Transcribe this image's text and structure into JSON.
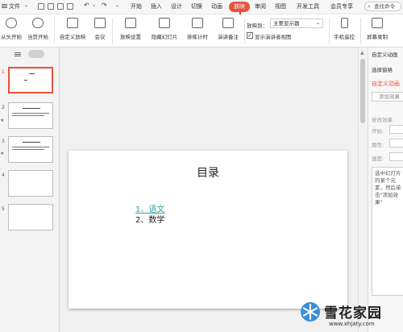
{
  "menubar": {
    "file_label": "文件",
    "tabs": [
      "开始",
      "插入",
      "设计",
      "切换",
      "动画",
      "放映",
      "审阅",
      "视图",
      "开发工具",
      "会员专享"
    ],
    "active_tab": "放映",
    "search_label": "查找命令"
  },
  "ribbon": {
    "from_start": "从头开始",
    "from_current": "当页开始",
    "custom_show": "自定义放映",
    "meeting": "会议",
    "show_settings": "放映设置",
    "hide_slide": "隐藏幻灯片",
    "rehearse": "排练计时",
    "speaker_notes": "演讲备注",
    "show_to_label": "放映到：",
    "show_to_value": "主要显示器",
    "presenter_view": "显示演讲者视图",
    "phone_remote": "手机遥控",
    "screen_record": "屏幕录制"
  },
  "thumbnails": {
    "numbers": [
      "1",
      "2",
      "3",
      "4",
      "5"
    ],
    "star": "★"
  },
  "slide": {
    "title": "目录",
    "items": [
      "1、语文",
      "2、数学"
    ],
    "item1_color": "#2aa6a6"
  },
  "right_panel": {
    "header": "自定义动画",
    "select_pane": "选择窗格",
    "custom_anim": "自定义动画",
    "add_effect": "添加效果",
    "modify_effect": "修改效果",
    "start": "开始:",
    "property": "属性:",
    "speed": "速度:",
    "hint": "选中幻灯片的某个元素，然后单击\"添加效果\""
  },
  "watermark": {
    "name": "雪花家园",
    "url": "www.xhjaty.com"
  },
  "colors": {
    "accent": "#e8533c",
    "teal": "#2aa6a6"
  }
}
